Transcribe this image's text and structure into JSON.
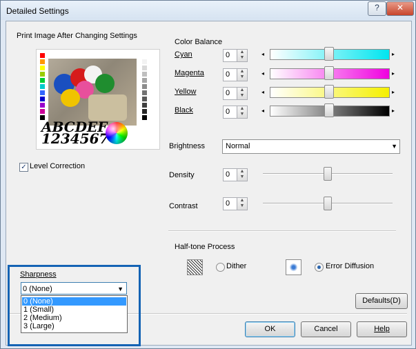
{
  "window": {
    "title": "Detailed Settings",
    "help_glyph": "?",
    "close_glyph": "✕"
  },
  "preview": {
    "label": "Print Image After Changing Settings",
    "sample_text_line1": "ABCDEF",
    "sample_text_line2": "1234567"
  },
  "level_correction": {
    "label": "Level Correction",
    "checked": true,
    "check_glyph": "✓"
  },
  "color_balance": {
    "heading": "Color Balance",
    "rows": [
      {
        "label": "Cyan",
        "value": "0",
        "color": "#00e5ef"
      },
      {
        "label": "Magenta",
        "value": "0",
        "color": "#f000e0"
      },
      {
        "label": "Yellow",
        "value": "0",
        "color": "#f5f000"
      },
      {
        "label": "Black",
        "value": "0",
        "color": "#000000"
      }
    ],
    "arrow_left": "◂",
    "arrow_right": "▸"
  },
  "brightness": {
    "label": "Brightness",
    "selected": "Normal",
    "caret": "▼"
  },
  "density": {
    "label": "Density",
    "value": "0"
  },
  "contrast": {
    "label": "Contrast",
    "value": "0"
  },
  "spinner": {
    "up": "▲",
    "down": "▼"
  },
  "halftone": {
    "heading": "Half-tone Process",
    "options": [
      {
        "label": "Dither",
        "selected": false
      },
      {
        "label": "Error Diffusion",
        "selected": true
      }
    ]
  },
  "sharpness": {
    "label": "Sharpness",
    "selected": "0 (None)",
    "caret": "▼",
    "options": [
      "0 (None)",
      "1 (Small)",
      "2 (Medium)",
      "3 (Large)"
    ],
    "highlight_color": "#1463b4"
  },
  "buttons": {
    "defaults": "Defaults(D)",
    "ok": "OK",
    "cancel": "Cancel",
    "help": "Help"
  }
}
